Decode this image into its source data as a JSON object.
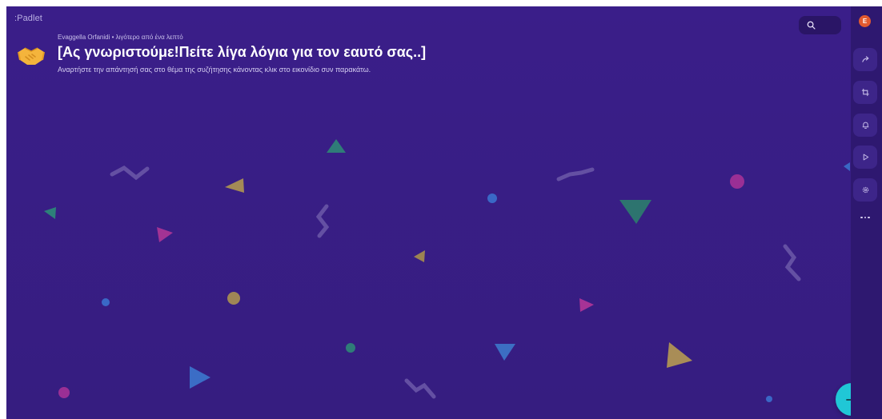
{
  "app": {
    "logo_text": ":Padlet"
  },
  "board": {
    "author": "Evaggella Orfanidi",
    "separator": "•",
    "time_ago": "λιγότερο από ένα λεπτό",
    "title": "[Ας γνωριστούμε!Πείτε λίγα λόγια για τον εαυτό σας..]",
    "description": "Αναρτήστε την απάντησή σας στο θέμα της συζήτησης κάνοντας κλικ στο εικονίδιο συν παρακάτω."
  },
  "user": {
    "avatar_initial": "E",
    "avatar_color": "#e25a2f"
  },
  "colors": {
    "board_bg": "#3a1e89",
    "rail_bg": "#2e1870",
    "fab_bg": "#20c7d6"
  },
  "icons": {
    "board_icon": "handshake-icon",
    "search": "search-icon",
    "share": "share-icon",
    "remake": "remake-icon",
    "notifications": "bell-icon",
    "slideshow": "play-icon",
    "settings": "gear-icon",
    "more": "more-icon",
    "add": "plus-icon"
  }
}
